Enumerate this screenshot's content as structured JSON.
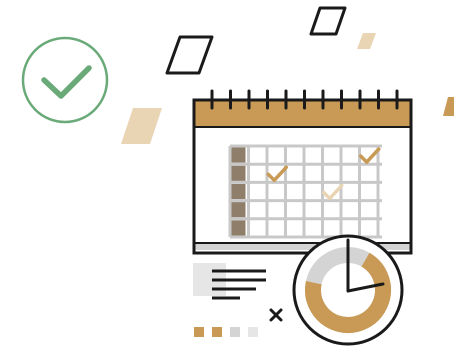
{
  "illustration": {
    "subject": "calendar-with-clock",
    "icons": [
      "check-circle-icon",
      "calendar-icon",
      "clock-icon",
      "document-lines-icon",
      "close-icon"
    ],
    "colors": {
      "accent": "#c99a55",
      "accent_light": "#e9d4b3",
      "green": "#6aaa78",
      "dark": "#1a1a1a",
      "grid": "#c8c8c8",
      "row_header": "#8f7e6a",
      "light_gray": "#d4d4d4",
      "paper": "#e6e6e6"
    },
    "calendar": {
      "rows": 5,
      "cols": 8,
      "checked_cells": [
        {
          "row": 1,
          "col": 2,
          "tone": "accent"
        },
        {
          "row": 0,
          "col": 7,
          "tone": "accent"
        },
        {
          "row": 2,
          "col": 5,
          "tone": "accent_light"
        }
      ]
    },
    "clock": {
      "ring_fraction_accent": 0.7
    },
    "legend_squares": [
      "accent",
      "accent",
      "light_gray",
      "paper"
    ]
  }
}
